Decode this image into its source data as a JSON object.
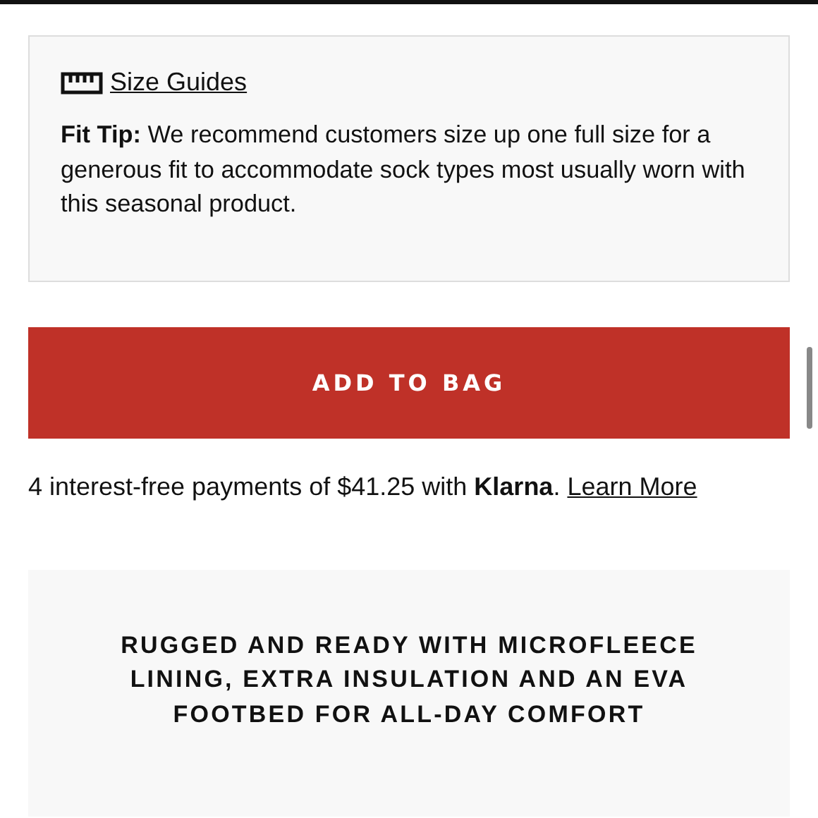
{
  "size_guide": {
    "link": "Size Guides",
    "fit_tip": "**Fit Tip:** We recommend customers size up one full size for a generous fit to accommodate sock types most usually worn with this seasonal product."
  },
  "add_to_bag": {
    "label": "ADD TO BAG"
  },
  "payment": {
    "text": "4 interest-free payments of $41.25 with **Klarna**.",
    "link": "Learn More"
  },
  "feature": {
    "heading": "RUGGED AND READY WITH MICROFLEECE LINING, EXTRA INSULATION AND AN EVA FOOTBED FOR ALL-DAY COMFORT"
  }
}
